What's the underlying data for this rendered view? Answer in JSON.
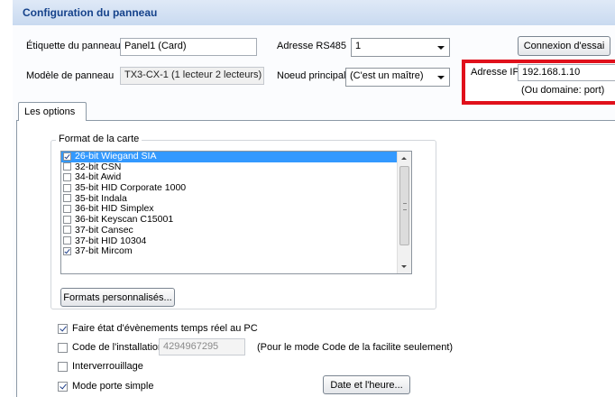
{
  "header": {
    "title": "Configuration du panneau"
  },
  "fields": {
    "panel_label": {
      "label": "Étiquette du panneau",
      "value": "Panel1 (Card)"
    },
    "panel_model": {
      "label": "Modèle de panneau",
      "value": "TX3-CX-1 (1 lecteur 2 lecteurs)"
    },
    "rs485": {
      "label": "Adresse RS485",
      "value": "1"
    },
    "main_node": {
      "label": "Noeud principal",
      "value": "(C'est un maître)"
    },
    "ip": {
      "label": "Adresse IP",
      "value": "192.168.1.10",
      "hint": "(Ou domaine: port)"
    }
  },
  "buttons": {
    "test_connection": "Connexion d'essai",
    "custom_formats": "Formats personnalisés...",
    "date_time": "Date et l'heure..."
  },
  "tabs": [
    {
      "label": "Les options",
      "active": true
    }
  ],
  "card_format": {
    "group_title": "Format de la carte",
    "items": [
      {
        "label": "26-bit Wiegand SIA",
        "checked": true,
        "selected": true
      },
      {
        "label": "32-bit CSN",
        "checked": false,
        "selected": false
      },
      {
        "label": "34-bit Awid",
        "checked": false,
        "selected": false
      },
      {
        "label": "35-bit HID Corporate 1000",
        "checked": false,
        "selected": false
      },
      {
        "label": "35-bit Indala",
        "checked": false,
        "selected": false
      },
      {
        "label": "36-bit HID Simplex",
        "checked": false,
        "selected": false
      },
      {
        "label": "36-bit Keyscan C15001",
        "checked": false,
        "selected": false
      },
      {
        "label": "37-bit Cansec",
        "checked": false,
        "selected": false
      },
      {
        "label": "37-bit HID 10304",
        "checked": false,
        "selected": false
      },
      {
        "label": "37-bit Mircom",
        "checked": true,
        "selected": false
      }
    ]
  },
  "options": {
    "realtime_events": {
      "label": "Faire état d'évènements temps réel au PC",
      "checked": true
    },
    "facility_code": {
      "label": "Code de l'installation",
      "checked": false,
      "value": "4294967295",
      "note": "(Pour le mode Code de la facilite seulement)"
    },
    "interlock": {
      "label": "Interverrouillage",
      "checked": false
    },
    "single_door": {
      "label": "Mode porte simple",
      "checked": true
    }
  },
  "colors": {
    "header_text": "#15428b",
    "highlight_box": "#e0101b",
    "selection": "#3399ff"
  }
}
